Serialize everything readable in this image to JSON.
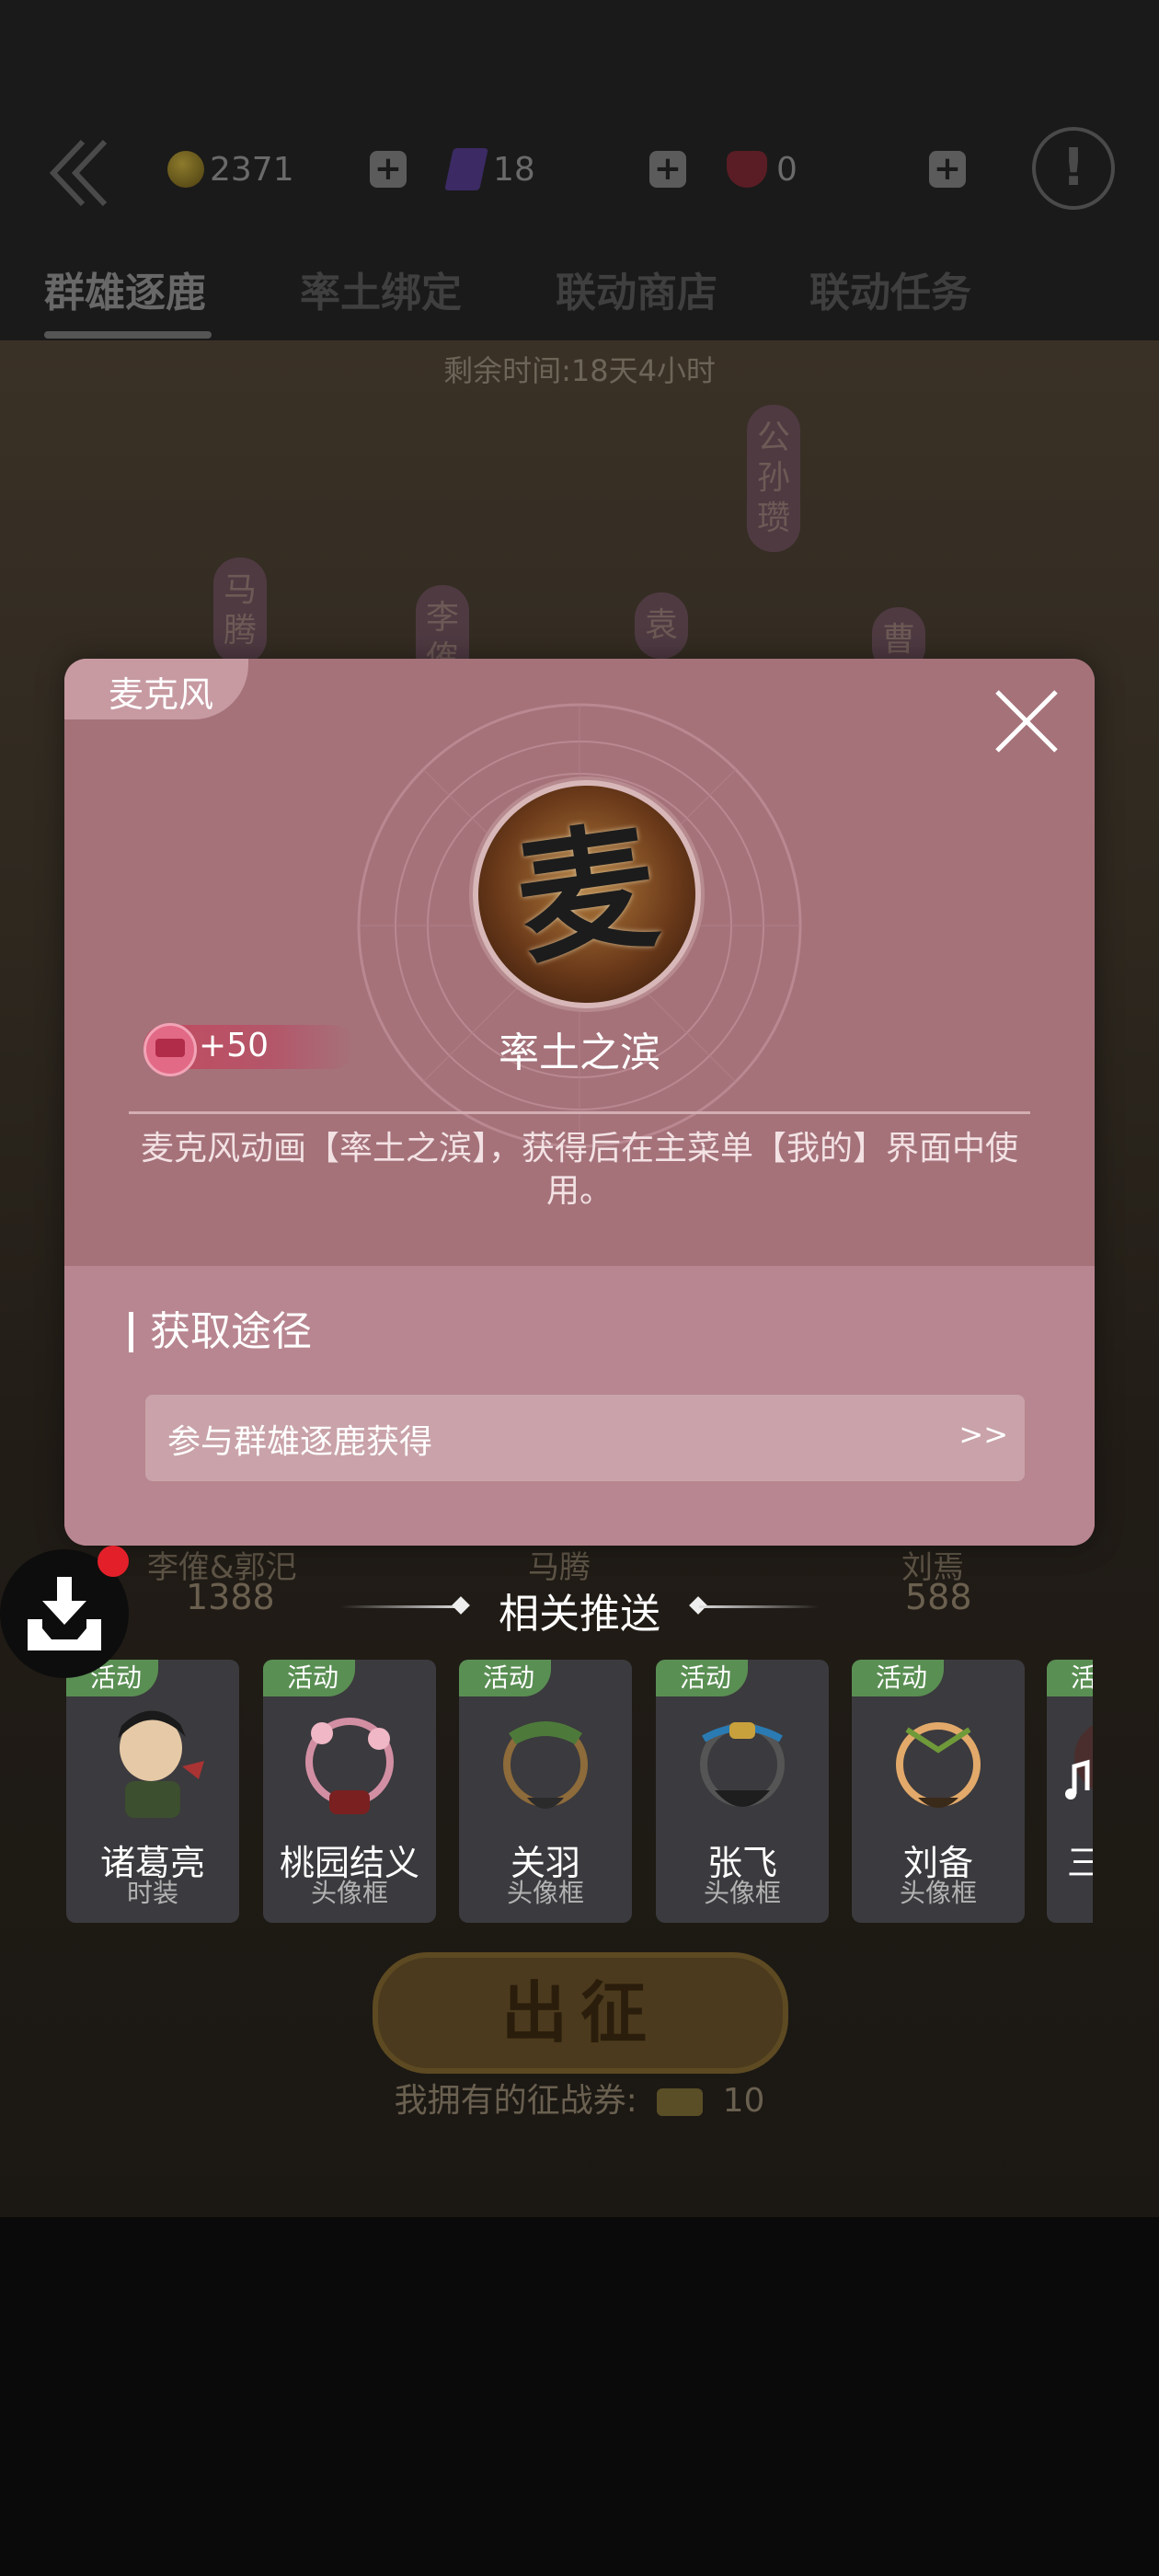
{
  "topbar": {
    "coins": "2371",
    "purple_gems": "18",
    "red_gems": "0"
  },
  "tabs": [
    "群雄逐鹿",
    "率土绑定",
    "联动商店",
    "联动任务"
  ],
  "background": {
    "remaining_time": "剩余时间:18天4小时",
    "map_labels": [
      "马腾",
      "李傕",
      "袁",
      "曹",
      "公孙瓒"
    ],
    "stats": [
      {
        "label": "李傕&郭汜",
        "value": "1388"
      },
      {
        "label": "马腾",
        "value": ""
      },
      {
        "label": "刘焉",
        "value": "588"
      }
    ],
    "sortie_label": "出征",
    "tickets_label": "我拥有的征战券:",
    "tickets_value": "10"
  },
  "modal": {
    "ribbon": "麦克风",
    "item_title": "率土之滨",
    "avatar_glyph": "麦",
    "bonus": "+50",
    "description": "麦克风动画【率土之滨】，获得后在主菜单【我的】界面中使用。",
    "section_title": "获取途径",
    "path_text": "参与群雄逐鹿获得",
    "path_arrow": ">>"
  },
  "related": {
    "title": "相关推送",
    "cards": [
      {
        "tag": "活动",
        "name": "诸葛亮",
        "type": "时装"
      },
      {
        "tag": "活动",
        "name": "桃园结义",
        "type": "头像框"
      },
      {
        "tag": "活动",
        "name": "关羽",
        "type": "头像框"
      },
      {
        "tag": "活动",
        "name": "张飞",
        "type": "头像框"
      },
      {
        "tag": "活动",
        "name": "刘备",
        "type": "头像框"
      },
      {
        "tag": "活",
        "name": "三",
        "type": ""
      }
    ]
  }
}
